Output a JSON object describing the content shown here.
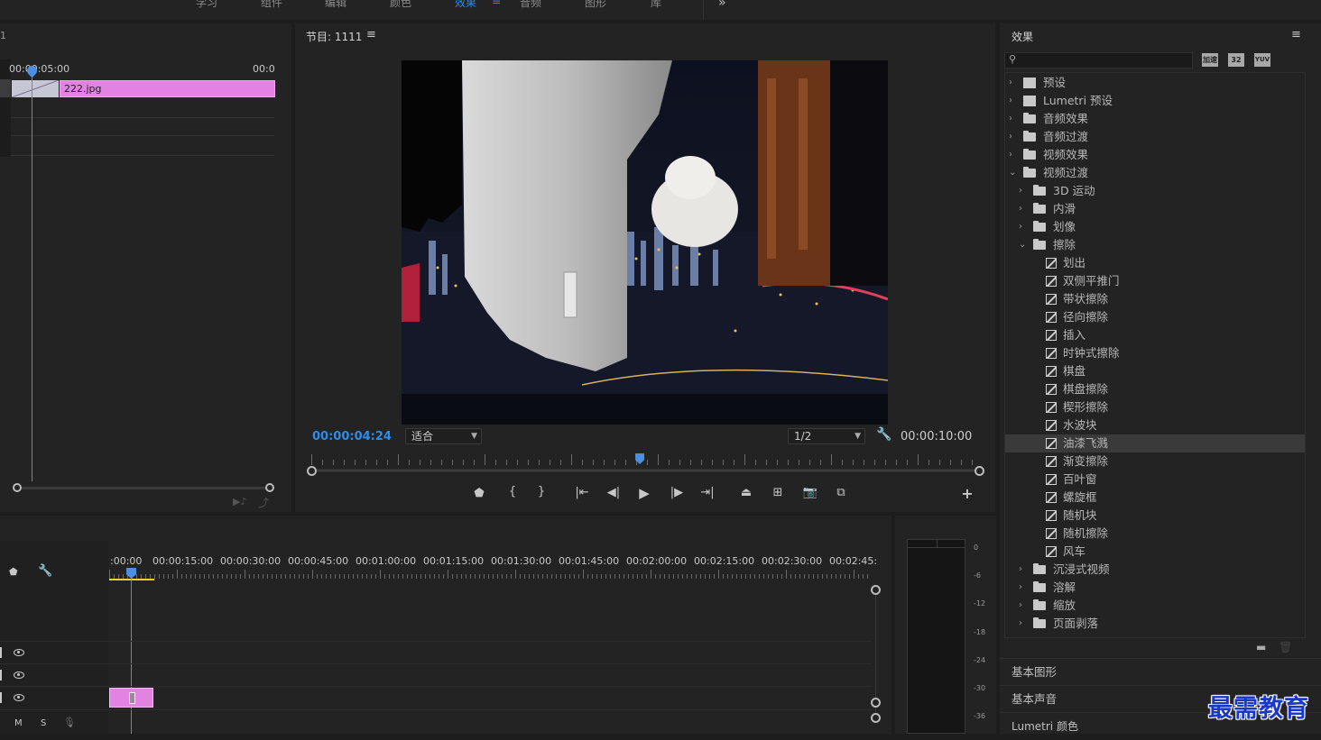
{
  "workspace": {
    "tabs": [
      "学习",
      "组件",
      "编辑",
      "颜色",
      "效果",
      "音频",
      "图形",
      "库"
    ],
    "active_tab": "效果",
    "overflow": "»"
  },
  "source": {
    "label": "1",
    "ruler_start": "00:00:05:00",
    "ruler_end": "00:0",
    "clip_name": "222.jpg"
  },
  "program": {
    "title": "节目: 1111",
    "menu": "≡",
    "current_time": "00:00:04:24",
    "fit_select": "适合",
    "res_select": "1/2",
    "duration": "00:00:10:00",
    "playhead_fraction": 0.492,
    "add_button": "+"
  },
  "effects": {
    "title": "效果",
    "menu": "≡",
    "search_placeholder": "",
    "filter_icons": [
      "加速",
      "32",
      "YUV"
    ],
    "tree": [
      {
        "label": "预设",
        "type": "preset",
        "level": 0,
        "expanded": false
      },
      {
        "label": "Lumetri 预设",
        "type": "preset",
        "level": 0,
        "expanded": false
      },
      {
        "label": "音频效果",
        "type": "folder",
        "level": 0,
        "expanded": false
      },
      {
        "label": "音频过渡",
        "type": "folder",
        "level": 0,
        "expanded": false
      },
      {
        "label": "视频效果",
        "type": "folder",
        "level": 0,
        "expanded": false
      },
      {
        "label": "视频过渡",
        "type": "folder",
        "level": 0,
        "expanded": true
      },
      {
        "label": "3D 运动",
        "type": "folder",
        "level": 1,
        "expanded": false
      },
      {
        "label": "内滑",
        "type": "folder",
        "level": 1,
        "expanded": false
      },
      {
        "label": "划像",
        "type": "folder",
        "level": 1,
        "expanded": false
      },
      {
        "label": "擦除",
        "type": "folder",
        "level": 1,
        "expanded": true
      },
      {
        "label": "划出",
        "type": "item",
        "level": 2
      },
      {
        "label": "双侧平推门",
        "type": "item",
        "level": 2
      },
      {
        "label": "带状擦除",
        "type": "item",
        "level": 2
      },
      {
        "label": "径向擦除",
        "type": "item",
        "level": 2
      },
      {
        "label": "插入",
        "type": "item",
        "level": 2
      },
      {
        "label": "时钟式擦除",
        "type": "item",
        "level": 2
      },
      {
        "label": "棋盘",
        "type": "item",
        "level": 2
      },
      {
        "label": "棋盘擦除",
        "type": "item",
        "level": 2
      },
      {
        "label": "楔形擦除",
        "type": "item",
        "level": 2
      },
      {
        "label": "水波块",
        "type": "item",
        "level": 2
      },
      {
        "label": "油漆飞溅",
        "type": "item",
        "level": 2,
        "selected": true
      },
      {
        "label": "渐变擦除",
        "type": "item",
        "level": 2
      },
      {
        "label": "百叶窗",
        "type": "item",
        "level": 2
      },
      {
        "label": "螺旋框",
        "type": "item",
        "level": 2
      },
      {
        "label": "随机块",
        "type": "item",
        "level": 2
      },
      {
        "label": "随机擦除",
        "type": "item",
        "level": 2
      },
      {
        "label": "风车",
        "type": "item",
        "level": 2
      },
      {
        "label": "沉浸式视频",
        "type": "folder",
        "level": 1,
        "expanded": false
      },
      {
        "label": "溶解",
        "type": "folder",
        "level": 1,
        "expanded": false
      },
      {
        "label": "缩放",
        "type": "folder",
        "level": 1,
        "expanded": false
      },
      {
        "label": "页面剥落",
        "type": "folder",
        "level": 1,
        "expanded": false
      }
    ],
    "sections": [
      "基本图形",
      "基本声音",
      "Lumetri 颜色"
    ]
  },
  "timeline": {
    "ruler": [
      ":00:00",
      "00:00:15:00",
      "00:00:30:00",
      "00:00:45:00",
      "00:01:00:00",
      "00:01:15:00",
      "00:01:30:00",
      "00:01:45:00",
      "00:02:00:00",
      "00:02:15:00",
      "00:02:30:00",
      "00:02:45:"
    ],
    "audio_controls": {
      "mute": "M",
      "solo": "S"
    }
  },
  "meter": {
    "scale": [
      "0",
      "-6",
      "-12",
      "-18",
      "-24",
      "-30",
      "-36"
    ]
  },
  "watermark": "最需教育",
  "colors": {
    "accent": "#2d8ceb",
    "clip": "#e283e2",
    "playhead": "#4a8fe0",
    "work_area": "#e8d22a"
  }
}
